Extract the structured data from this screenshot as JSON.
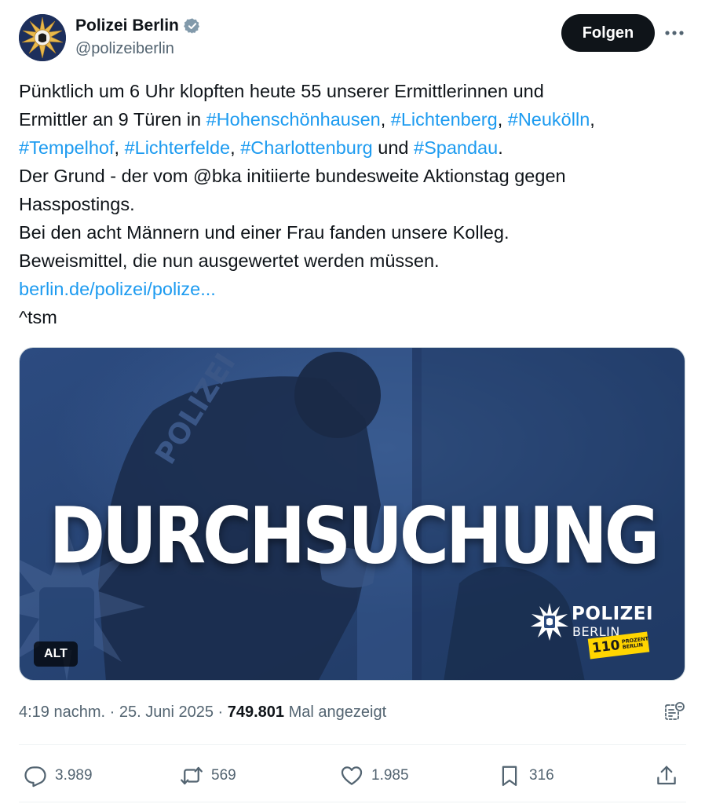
{
  "account": {
    "display_name": "Polizei Berlin",
    "handle": "@polizeiberlin",
    "verified": true
  },
  "header": {
    "follow_label": "Folgen"
  },
  "tweet": {
    "lines": [
      [
        {
          "t": "text",
          "v": "Pünktlich um 6 Uhr klopften heute 55 unserer Ermittlerinnen und"
        }
      ],
      [
        {
          "t": "text",
          "v": "Ermittler an 9 Türen in "
        },
        {
          "t": "hashtag",
          "v": "#Hohenschönhausen"
        },
        {
          "t": "text",
          "v": ", "
        },
        {
          "t": "hashtag",
          "v": "#Lichtenberg"
        },
        {
          "t": "text",
          "v": ", "
        },
        {
          "t": "hashtag",
          "v": "#Neukölln"
        },
        {
          "t": "text",
          "v": ","
        }
      ],
      [
        {
          "t": "hashtag",
          "v": "#Tempelhof"
        },
        {
          "t": "text",
          "v": ", "
        },
        {
          "t": "hashtag",
          "v": "#Lichterfelde"
        },
        {
          "t": "text",
          "v": ", "
        },
        {
          "t": "hashtag",
          "v": "#Charlottenburg"
        },
        {
          "t": "text",
          "v": " und "
        },
        {
          "t": "hashtag",
          "v": "#Spandau"
        },
        {
          "t": "text",
          "v": "."
        }
      ],
      [
        {
          "t": "text",
          "v": "Der Grund - der vom @bka initiierte bundesweite Aktionstag gegen"
        }
      ],
      [
        {
          "t": "text",
          "v": "Hasspostings."
        }
      ],
      [
        {
          "t": "text",
          "v": "Bei den acht Männern und einer Frau fanden unsere Kolleg."
        }
      ],
      [
        {
          "t": "text",
          "v": "Beweismittel, die nun ausgewertet werden müssen."
        }
      ],
      [
        {
          "t": "link",
          "v": "berlin.de/polizei/polize..."
        }
      ],
      [
        {
          "t": "text",
          "v": "^tsm"
        }
      ]
    ]
  },
  "media": {
    "title": "DURCHSUCHUNG",
    "alt_label": "ALT",
    "logo_word": "POLIZEI",
    "logo_sub": "BERLIN",
    "badge_number": "110",
    "badge_text_1": "PROZENT",
    "badge_text_2": "BERLIN",
    "vest_text": "POLIZEI",
    "background_color": "#2b4a7e",
    "badge_color": "#ffd500"
  },
  "meta": {
    "time": "4:19 nachm.",
    "separator": " · ",
    "date": "25. Juni 2025",
    "views": "749.801",
    "views_label": "Mal angezeigt"
  },
  "actions": {
    "replies": "3.989",
    "reposts": "569",
    "likes": "1.985",
    "bookmarks": "316"
  },
  "colors": {
    "accent": "#1d9bf0",
    "text": "#0f1419",
    "secondary": "#536471",
    "verified": "#829aab"
  },
  "icons": [
    "police-star-icon",
    "verified-badge-icon",
    "more-options-icon",
    "analytics-icon",
    "reply-icon",
    "repost-icon",
    "like-icon",
    "bookmark-icon",
    "share-icon"
  ]
}
